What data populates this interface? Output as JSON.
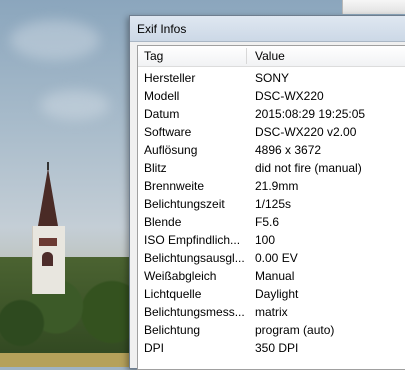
{
  "window": {
    "title": "Exif Infos"
  },
  "columns": {
    "tag": "Tag",
    "value": "Value"
  },
  "rows": [
    {
      "tag": "Hersteller",
      "value": "SONY"
    },
    {
      "tag": "Modell",
      "value": "DSC-WX220"
    },
    {
      "tag": "Datum",
      "value": "2015:08:29 19:25:05"
    },
    {
      "tag": "Software",
      "value": "DSC-WX220 v2.00"
    },
    {
      "tag": "Auflösung",
      "value": "4896 x 3672"
    },
    {
      "tag": "Blitz",
      "value": "did not fire (manual)"
    },
    {
      "tag": "Brennweite",
      "value": "21.9mm"
    },
    {
      "tag": "Belichtungszeit",
      "value": "1/125s"
    },
    {
      "tag": "Blende",
      "value": "F5.6"
    },
    {
      "tag": "ISO Empfindlich...",
      "value": "100"
    },
    {
      "tag": "Belichtungsausgl...",
      "value": "0.00 EV"
    },
    {
      "tag": "Weißabgleich",
      "value": "Manual"
    },
    {
      "tag": "Lichtquelle",
      "value": "Daylight"
    },
    {
      "tag": "Belichtungsmess...",
      "value": "matrix"
    },
    {
      "tag": "Belichtung",
      "value": "program (auto)"
    },
    {
      "tag": "DPI",
      "value": "350 DPI"
    }
  ]
}
